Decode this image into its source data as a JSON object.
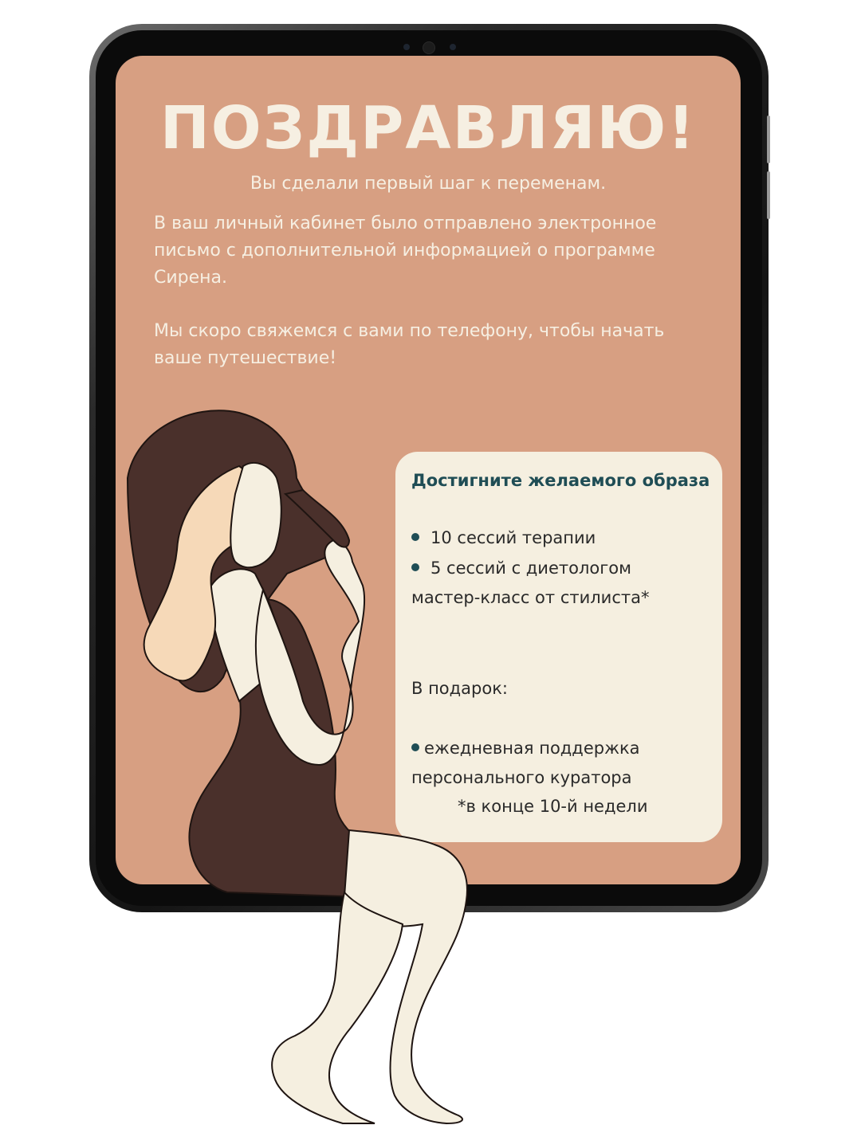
{
  "screen": {
    "headline": "ПОЗДРАВЛЯЮ!",
    "subtitle": "Вы сделали первый шаг к переменам.",
    "paragraph1_lines": [
      "В ваш личный кабинет было отправлено электронное",
      "письмо с дополнительной информацией о программе",
      "Сирена."
    ],
    "paragraph2_lines": [
      "Мы скоро свяжемся с вами по телефону, чтобы начать",
      "ваше путешествие!"
    ]
  },
  "card": {
    "title": "Достигните желаемого образа",
    "items": [
      "10 сессий терапии",
      "5 сессий с диетологом"
    ],
    "extra_line": "мастер-класс от стилиста*",
    "gift_label": "В подарок:",
    "gift_lines": [
      "ежедневная поддержка",
      "персонального куратора"
    ],
    "footnote": "*в конце 10-й недели"
  },
  "colors": {
    "screen_bg": "#d79f82",
    "cream": "#f5efe0",
    "accent_teal": "#1f4d55",
    "hair_brown": "#4a302b",
    "hair_light": "#f6d9b8"
  },
  "icons": {
    "bullet": "bullet-dot-icon",
    "camera": "front-camera-icon"
  }
}
